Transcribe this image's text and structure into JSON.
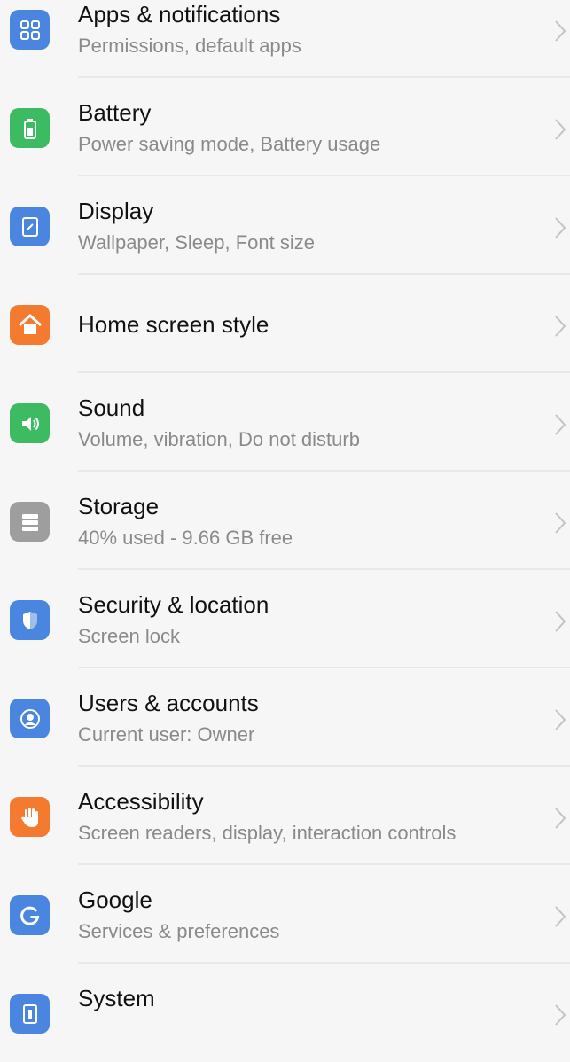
{
  "settings": {
    "items": [
      {
        "title": "Apps & notifications",
        "subtitle": "Permissions, default apps",
        "icon": "apps-grid-icon",
        "color": "#4a86e0"
      },
      {
        "title": "Battery",
        "subtitle": "Power saving mode, Battery usage",
        "icon": "battery-icon",
        "color": "#3dbb63"
      },
      {
        "title": "Display",
        "subtitle": "Wallpaper, Sleep, Font size",
        "icon": "display-icon",
        "color": "#4a86e0"
      },
      {
        "title": "Home screen style",
        "subtitle": "",
        "icon": "home-icon",
        "color": "#f47a2f"
      },
      {
        "title": "Sound",
        "subtitle": "Volume, vibration, Do not disturb",
        "icon": "speaker-icon",
        "color": "#3dbb63"
      },
      {
        "title": "Storage",
        "subtitle": "40% used - 9.66 GB free",
        "icon": "storage-icon",
        "color": "#9e9e9e"
      },
      {
        "title": "Security & location",
        "subtitle": "Screen lock",
        "icon": "shield-icon",
        "color": "#4a86e0"
      },
      {
        "title": "Users & accounts",
        "subtitle": "Current user: Owner",
        "icon": "user-icon",
        "color": "#4a86e0"
      },
      {
        "title": "Accessibility",
        "subtitle": "Screen readers, display, interaction controls",
        "icon": "hand-icon",
        "color": "#f47a2f"
      },
      {
        "title": "Google",
        "subtitle": "Services & preferences",
        "icon": "google-icon",
        "color": "#4a86e0"
      },
      {
        "title": "System",
        "subtitle": "",
        "icon": "system-phone-icon",
        "color": "#4a86e0"
      }
    ]
  }
}
